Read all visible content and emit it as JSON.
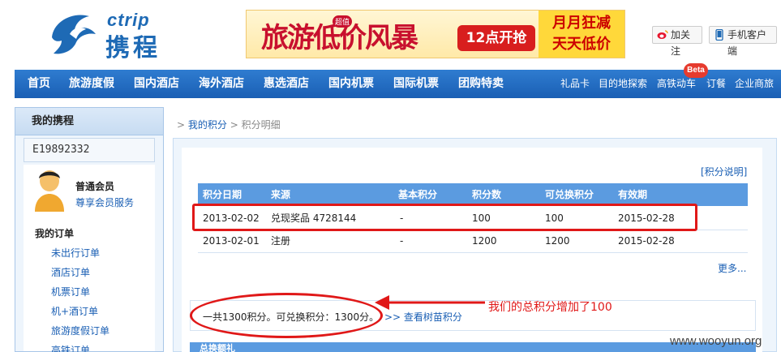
{
  "brand": {
    "logo_en": "ctrip",
    "logo_cn": "携程",
    "logo_color": "#1e6ab5"
  },
  "banner": {
    "main": "旅游低价风暴",
    "tag": "超值",
    "mid": "12点开抢",
    "right_line1": "月月狂减",
    "right_line2": "天天低价"
  },
  "header_buttons": {
    "weibo": "加关注",
    "mobile": "手机客户端"
  },
  "nav": {
    "main_items": [
      "首页",
      "旅游度假",
      "国内酒店",
      "海外酒店",
      "惠选酒店",
      "国内机票",
      "国际机票",
      "团购特卖"
    ],
    "sub_items": [
      "礼品卡",
      "目的地探索",
      "高铁动车",
      "订餐",
      "企业商旅"
    ],
    "beta_badge": "Beta",
    "bg_color": "#1a5fb4"
  },
  "sidebar": {
    "title": "我的携程",
    "user_id": "E19892332",
    "member_level": "普通会员",
    "member_link": "尊享会员服务",
    "orders_title": "我的订单",
    "order_links": [
      "未出行订单",
      "酒店订单",
      "机票订单",
      "机+酒订单",
      "旅游度假订单",
      "高铁订单"
    ]
  },
  "breadcrumb": {
    "sep": ">",
    "parent": "我的积分",
    "current": "积分明细"
  },
  "points": {
    "help_link": "[积分说明]",
    "columns": [
      "积分日期",
      "来源",
      "基本积分",
      "积分数",
      "可兑换积分",
      "有效期"
    ],
    "rows": [
      [
        "2013-02-02",
        "兑现奖品 4728144",
        "-",
        "100",
        "100",
        "2015-02-28"
      ],
      [
        "2013-02-01",
        "注册",
        "-",
        "1200",
        "1200",
        "2015-02-28"
      ]
    ],
    "more_link": "更多...",
    "summary_text": "一共1300积分。可兑换积分：1300分。",
    "summary_link": ">> 查看树苗积分",
    "bottom_bar_label": "总换额礼"
  },
  "annotations": {
    "note": "我们的总积分增加了100",
    "color": "#e01818"
  },
  "watermark": "www.wooyun.org"
}
